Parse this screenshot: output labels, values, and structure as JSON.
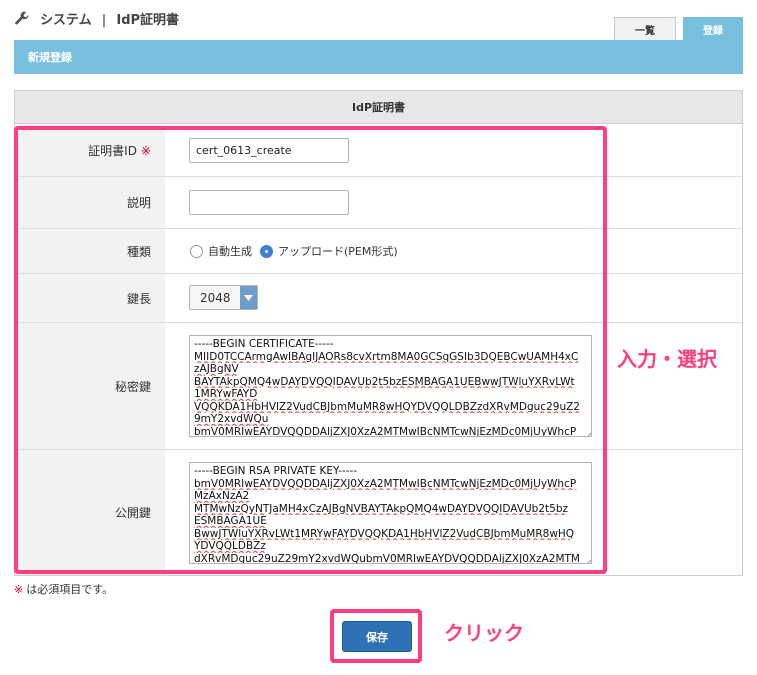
{
  "header": {
    "icon": "wrench-icon",
    "section": "システム",
    "separator": "|",
    "page": "IdP証明書"
  },
  "tabs": [
    {
      "label": "一覧",
      "active": false
    },
    {
      "label": "登録",
      "active": true
    }
  ],
  "banner": {
    "title": "新規登録"
  },
  "form": {
    "title": "IdP証明書",
    "required_mark": "※",
    "fields": {
      "cert_id": {
        "label": "証明書ID",
        "value": "cert_0613_create"
      },
      "description": {
        "label": "説明",
        "value": ""
      },
      "type": {
        "label": "種類",
        "options": [
          {
            "label": "自動生成",
            "selected": false
          },
          {
            "label": "アップロード(PEM形式)",
            "selected": true
          }
        ]
      },
      "key_length": {
        "label": "鍵長",
        "value": "2048"
      },
      "private_key": {
        "label": "秘密鍵",
        "lines": [
          "-----BEGIN CERTIFICATE-----",
          "MIID0TCCArmgAwIBAgIJAORs8cvXrtm8MA0GCSqGSIb3DQEBCwUAMH4xC",
          "zAJBgNV",
          "BAYTAkpQMQ4wDAYDVQQIDAVUb2t5bzESMBAGA1UEBwwJTWluYXRvLWt",
          "1MRYwFAYD",
          "VQQKDA1HbHVlZ2VudCBJbmMuMR8wHQYDVQQLDBZzdXRvMDguc29uZ2",
          "9mY2xvdWQu",
          "bmV0MRIwEAYDVQQDDAljZXJ0XzA2MTMwIBcNMTcwNjEzMDc0MjUyWhcP"
        ]
      },
      "public_key": {
        "label": "公開鍵",
        "lines": [
          "-----BEGIN RSA PRIVATE KEY-----",
          "bmV0MRIwEAYDVQQDDAljZXJ0XzA2MTMwIBcNMTcwNjEzMDc0MjUyWhcP",
          "MzAxNzA2",
          "MTMwNzQyNTJaMH4xCzAJBgNVBAYTAkpQMQ4wDAYDVQQIDAVUb2t5bz",
          "ESMBAGA1UE",
          "BwwJTWluYXRvLWt1MRYwFAYDVQQKDA1HbHVlZ2VudCBJbmMuMR8wHQ",
          "YDVQQLDBZz",
          "dXRvMDguc29uZ29mY2xvdWQubmV0MRIwEAYDVQQDDAljZXJ0XzA2MTM"
        ]
      }
    },
    "required_note": "は必須項目です。",
    "save_label": "保存"
  },
  "annotations": {
    "input_select": "入力・選択",
    "click": "クリック"
  },
  "colors": {
    "accent_blue": "#78c0de",
    "button_blue": "#2f71b5",
    "highlight_pink": "#ff3d7f",
    "required_red": "#d0021b"
  }
}
